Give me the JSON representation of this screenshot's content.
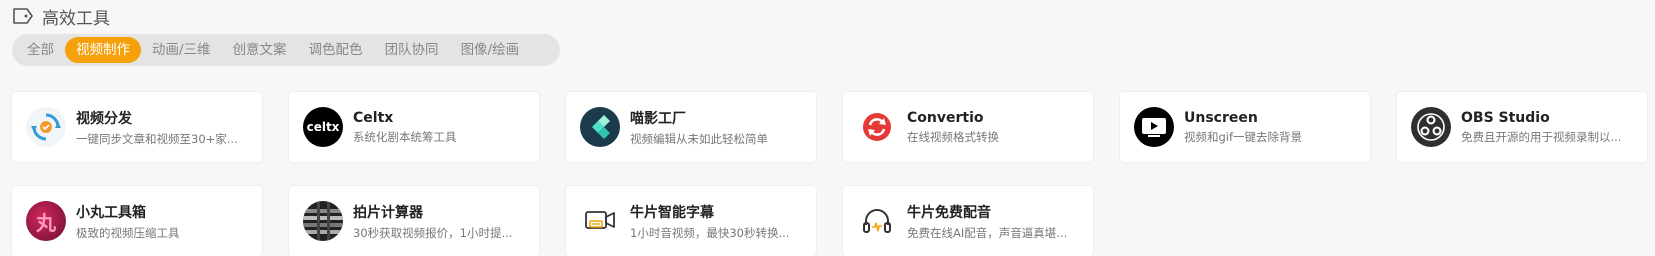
{
  "section": {
    "title": "高效工具",
    "icon": "tag-icon"
  },
  "tabs": [
    {
      "label": "全部",
      "active": false
    },
    {
      "label": "视频制作",
      "active": true
    },
    {
      "label": "动画/三维",
      "active": false
    },
    {
      "label": "创意文案",
      "active": false
    },
    {
      "label": "调色配色",
      "active": false
    },
    {
      "label": "团队协同",
      "active": false
    },
    {
      "label": "图像/绘画",
      "active": false
    }
  ],
  "tools": [
    {
      "name": "视频分发",
      "desc": "一键同步文章和视频至30+家...",
      "icon": "sync-icon",
      "color": "#f39a2b"
    },
    {
      "name": "Celtx",
      "desc": "系统化剧本统筹工具",
      "icon": "celtx-logo-icon",
      "logo_text": "celtx",
      "color": "#000000"
    },
    {
      "name": "喵影工厂",
      "desc": "视频编辑从未如此轻松简单",
      "icon": "filmora-logo-icon",
      "color": "#1b3a4b"
    },
    {
      "name": "Convertio",
      "desc": "在线视频格式转换",
      "icon": "convertio-logo-icon",
      "color": "#e53935"
    },
    {
      "name": "Unscreen",
      "desc": "视频和gif一键去除背景",
      "icon": "unscreen-logo-icon",
      "color": "#000000"
    },
    {
      "name": "OBS Studio",
      "desc": "免费且开源的用于视频录制以...",
      "icon": "obs-logo-icon",
      "color": "#302e31"
    },
    {
      "name": "小丸工具箱",
      "desc": "极致的视频压缩工具",
      "icon": "xiaowan-logo-icon",
      "logo_text": "丸",
      "color": "#9c1a4a"
    },
    {
      "name": "拍片计算器",
      "desc": "30秒获取视频报价，1小时提...",
      "icon": "calculator-logo-icon",
      "color": "#222222"
    },
    {
      "name": "牛片智能字幕",
      "desc": "1小时音视频，最快30秒转换...",
      "icon": "subtitle-camera-icon",
      "color": "#f5a10b"
    },
    {
      "name": "牛片免费配音",
      "desc": "免费在线AI配音，声音逼真堪...",
      "icon": "headphones-icon",
      "color": "#f5a10b"
    }
  ]
}
